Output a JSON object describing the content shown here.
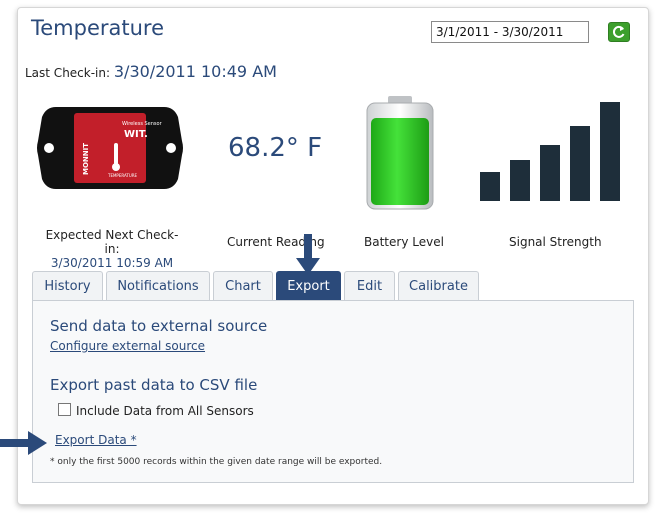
{
  "header": {
    "title": "Temperature",
    "date_range": "3/1/2011 - 3/30/2011",
    "refresh_icon": "refresh-icon"
  },
  "checkin": {
    "label": "Last Check-in:",
    "value": "3/30/2011 10:49 AM"
  },
  "sensor_badge": {
    "line1": "Wireless Sensor",
    "brand": "WIT.",
    "side": "MONNIT",
    "type": "TEMPERATURE"
  },
  "reading": {
    "value": "68.2° F",
    "label": "Current Reading"
  },
  "battery": {
    "label": "Battery Level",
    "level": 0.85,
    "color": "#2ec81f"
  },
  "signal": {
    "label": "Signal Strength",
    "bars": 5,
    "color": "#1e2e3a"
  },
  "next_checkin": {
    "label": "Expected Next Check-in:",
    "value": "3/30/2011 10:59 AM"
  },
  "tabs": [
    {
      "label": "History"
    },
    {
      "label": "Notifications"
    },
    {
      "label": "Chart"
    },
    {
      "label": "Export",
      "active": true
    },
    {
      "label": "Edit"
    },
    {
      "label": "Calibrate"
    }
  ],
  "export": {
    "external_heading": "Send data to external source",
    "configure_link": "Configure external source",
    "csv_heading": "Export past data to CSV file",
    "include_all_label": "Include Data from All Sensors",
    "include_all_checked": false,
    "export_link": "Export Data *",
    "footnote": "* only the first 5000 records within the given date range will be exported."
  },
  "colors": {
    "accent": "#2b4a7a",
    "arrow": "#2b4a7a"
  }
}
